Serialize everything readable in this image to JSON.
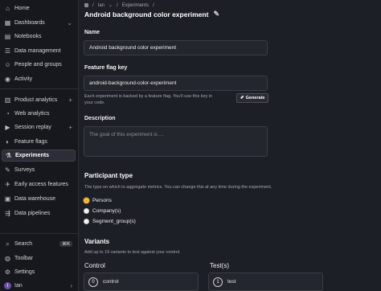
{
  "sidebar": {
    "items": [
      {
        "label": "Home",
        "icon": "home-icon"
      },
      {
        "label": "Dashboards",
        "icon": "dashboard-icon"
      },
      {
        "label": "Notebooks",
        "icon": "notebook-icon"
      },
      {
        "label": "Data management",
        "icon": "database-icon"
      },
      {
        "label": "People and groups",
        "icon": "people-icon"
      },
      {
        "label": "Activity",
        "icon": "activity-icon"
      },
      {
        "label": "Product analytics",
        "icon": "chart-icon"
      },
      {
        "label": "Web analytics",
        "icon": "web-analytics-icon"
      },
      {
        "label": "Session replay",
        "icon": "replay-icon"
      },
      {
        "label": "Feature flags",
        "icon": "toggle-icon"
      },
      {
        "label": "Experiments",
        "icon": "flask-icon"
      },
      {
        "label": "Surveys",
        "icon": "survey-icon"
      },
      {
        "label": "Early access features",
        "icon": "rocket-icon"
      },
      {
        "label": "Data warehouse",
        "icon": "warehouse-icon"
      },
      {
        "label": "Data pipelines",
        "icon": "pipeline-icon"
      }
    ],
    "bottom": {
      "search_label": "Search",
      "search_shortcut": "⌘K",
      "toolbar_label": "Toolbar",
      "settings_label": "Settings",
      "user_label": "Ian",
      "user_initial": "I"
    }
  },
  "breadcrumb": {
    "user": "Ian",
    "section": "Experiments"
  },
  "title": "Android background color experiment",
  "form": {
    "name_label": "Name",
    "name_value": "Android background color experiment",
    "flag_label": "Feature flag key",
    "flag_value": "android-background-color-experiment",
    "flag_help_line1": "Each experiment is backed by a feature flag. You'll use this key in",
    "flag_help_line2": "your code.",
    "generate_label": "Generate",
    "description_label": "Description",
    "description_placeholder": "The goal of this experiment is ...",
    "participant_title": "Participant type",
    "participant_help": "The type on which to aggregate metrics. You can change this at any time during the experiment.",
    "participant_options": [
      "Persons",
      "Company(s)",
      "Segment_group(s)"
    ],
    "variants_title": "Variants",
    "variants_help": "Add up to 19 variants to test against your control.",
    "control_label": "Control",
    "test_label": "Test(s)",
    "control_number": "0",
    "control_value": "control",
    "test_number": "1",
    "test_value": "test"
  },
  "colors": {
    "background": "#1d1f27",
    "sidebar": "#16181d",
    "accent_radio": "#f1a82c"
  }
}
